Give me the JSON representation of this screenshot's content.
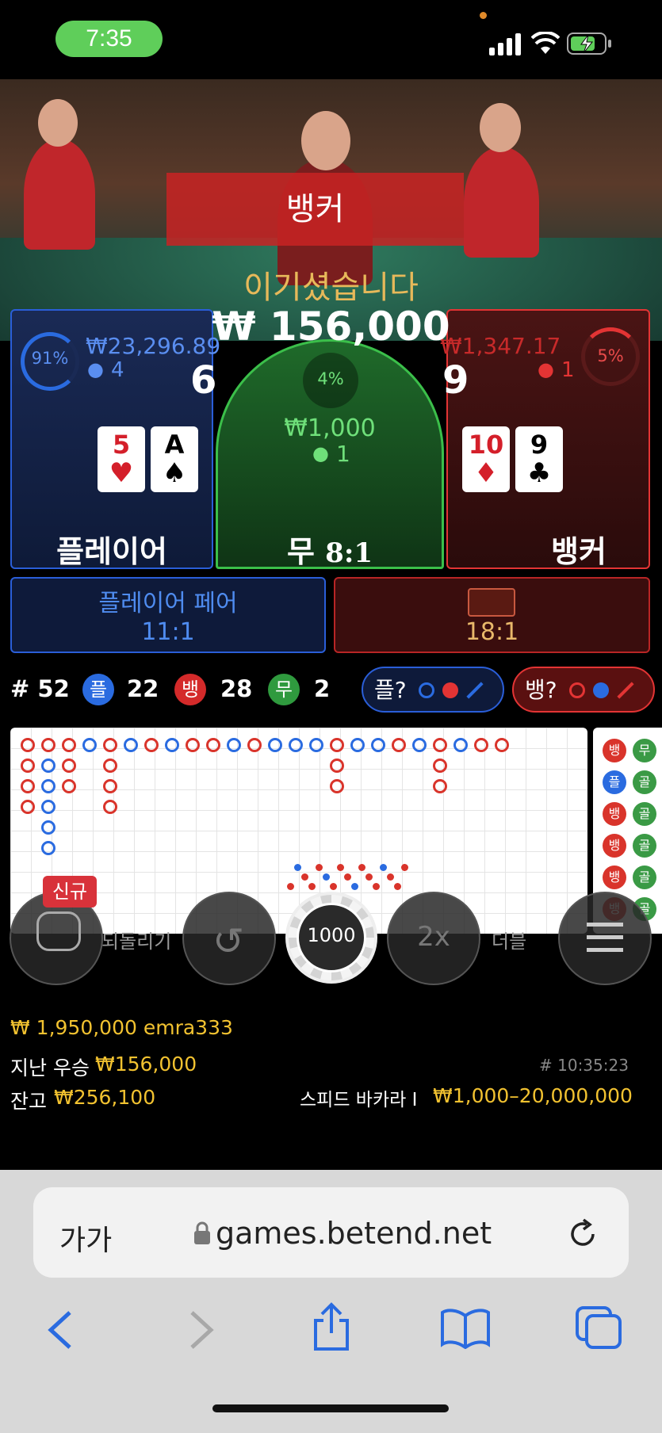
{
  "status_bar": {
    "time": "7:35"
  },
  "result": {
    "winner_banner": "뱅커",
    "win_text": "이기셨습니다",
    "win_amount": "₩ 156,000"
  },
  "player": {
    "percent": "91%",
    "total": "₩23,296.89",
    "bettors": "4",
    "score": "6",
    "label": "플레이어",
    "cards": [
      {
        "rank": "5",
        "suit": "♥",
        "color": "red"
      },
      {
        "rank": "A",
        "suit": "♠",
        "color": "black"
      }
    ]
  },
  "tie": {
    "percent": "4%",
    "total": "₩1,000",
    "bettors": "1",
    "label": "무",
    "payout": "8:1"
  },
  "banker": {
    "percent": "5%",
    "total": "₩1,347.17",
    "bettors": "1",
    "score": "9",
    "label": "뱅커",
    "cards": [
      {
        "rank": "10",
        "suit": "♦",
        "color": "red"
      },
      {
        "rank": "9",
        "suit": "♣",
        "color": "black"
      }
    ]
  },
  "pairs": {
    "player_pair_label": "플레이어 페어",
    "player_pair_payout": "11:1",
    "banker_pair_payout": "18:1"
  },
  "stats": {
    "round": "# 52",
    "player_short": "플",
    "player_count": "22",
    "banker_short": "뱅",
    "banker_count": "28",
    "tie_short": "무",
    "tie_count": "2",
    "predict_player": "플?",
    "predict_banker": "뱅?"
  },
  "road_side": [
    "뱅",
    "플",
    "뱅",
    "뱅",
    "뱅",
    "뱅"
  ],
  "road_side2": [
    "무",
    "골",
    "골",
    "골",
    "골",
    "골"
  ],
  "controls": {
    "new_badge": "신규",
    "undo_label": "되돌리기",
    "chip_value": "1000",
    "double_text": "2x",
    "double_label": "더블"
  },
  "info": {
    "top_line": "₩ 1,950,000 emra333",
    "last_win_label": "지난 우승",
    "last_win_amount": "₩156,000",
    "timestamp": "# 10:35:23",
    "balance_label": "잔고",
    "balance_amount": "₩256,100",
    "game_name": "스피드 바카라 I",
    "limits": "₩1,000–20,000,000"
  },
  "browser": {
    "text_size": "가가",
    "url": "games.betend.net"
  },
  "colors": {
    "player_blue": "#2a5ed8",
    "banker_red": "#e33434",
    "tie_green": "#3bbf4a",
    "gold": "#f2c230"
  }
}
